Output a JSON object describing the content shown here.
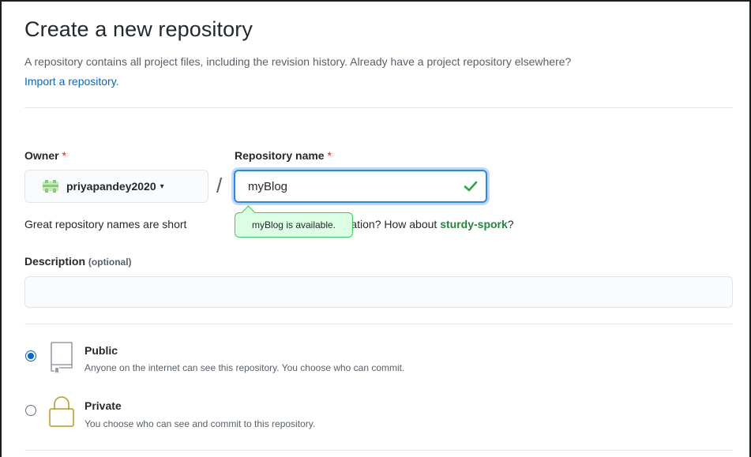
{
  "page": {
    "title": "Create a new repository",
    "subtitle": "A repository contains all project files, including the revision history. Already have a project repository elsewhere?",
    "import_link": "Import a repository."
  },
  "owner": {
    "label": "Owner",
    "required_mark": "*",
    "value": "priyapandey2020",
    "caret": "▾"
  },
  "separator": "/",
  "repository": {
    "label": "Repository name",
    "required_mark": "*",
    "value": "myBlog",
    "availability": "myBlog is available."
  },
  "hint": {
    "prefix": "Great repository names are short",
    "middle": "ed inspiration? How about",
    "suggestion": "sturdy-spork",
    "suffix": "?"
  },
  "description": {
    "label": "Description",
    "optional": "(optional)",
    "value": ""
  },
  "visibility": {
    "public": {
      "title": "Public",
      "desc": "Anyone on the internet can see this repository. You choose who can commit.",
      "checked": true
    },
    "private": {
      "title": "Private",
      "desc": "You choose who can see and commit to this repository.",
      "checked": false
    }
  },
  "colors": {
    "accent": "#0366d6",
    "success": "#28a745",
    "required": "#cb2431",
    "suggestion": "#22863a"
  }
}
